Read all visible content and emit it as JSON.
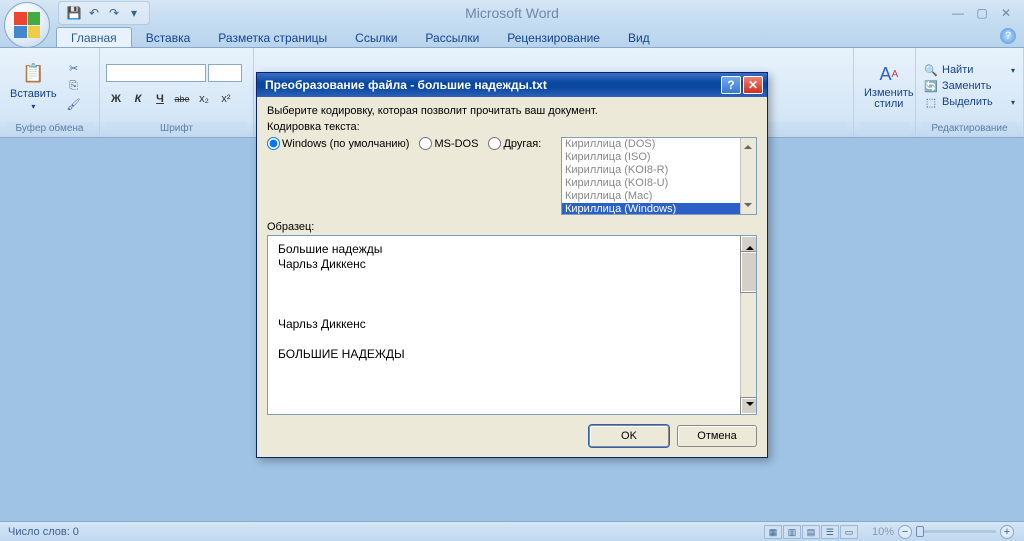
{
  "app_title": "Microsoft Word",
  "tabs": [
    "Главная",
    "Вставка",
    "Разметка страницы",
    "Ссылки",
    "Рассылки",
    "Рецензирование",
    "Вид"
  ],
  "ribbon": {
    "paste": "Вставить",
    "clipboard_group": "Буфер обмена",
    "font_group": "Шрифт",
    "styles_btn": "Изменить стили",
    "find": "Найти",
    "replace": "Заменить",
    "select": "Выделить",
    "editing_group": "Редактирование",
    "bold": "Ж",
    "italic": "К",
    "underline": "Ч",
    "strike": "abe",
    "sub": "x₂",
    "sup": "x²"
  },
  "status": {
    "words": "Число слов: 0",
    "zoom": "10%"
  },
  "dialog": {
    "title": "Преобразование файла - большие надежды.txt",
    "prompt": "Выберите кодировку, которая позволит прочитать ваш документ.",
    "encoding_label": "Кодировка текста:",
    "radios": {
      "windows": "Windows (по умолчанию)",
      "msdos": "MS-DOS",
      "other": "Другая:"
    },
    "encodings": [
      "Кириллица (DOS)",
      "Кириллица (ISO)",
      "Кириллица (KOI8-R)",
      "Кириллица (KOI8-U)",
      "Кириллица (Mac)",
      "Кириллица (Windows)"
    ],
    "sample_label": "Образец:",
    "sample_text": "Большие надежды\nЧарльз Диккенс\n\n\n\nЧарльз Диккенс\n\nБОЛЬШИЕ НАДЕЖДЫ",
    "ok": "OK",
    "cancel": "Отмена"
  }
}
